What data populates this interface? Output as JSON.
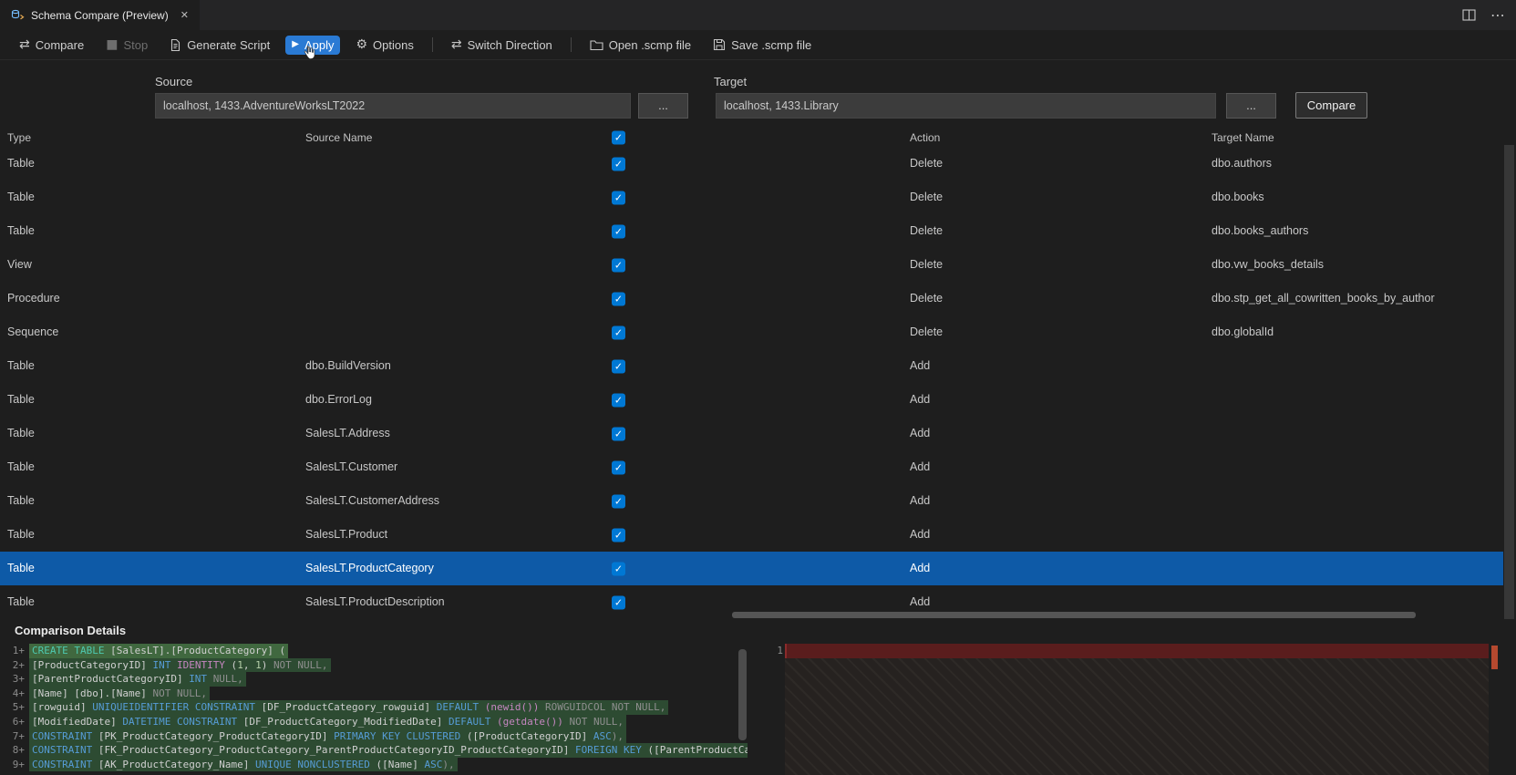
{
  "tab": {
    "title": "Schema Compare (Preview)",
    "close_glyph": "✕",
    "more_glyph": "⋯"
  },
  "toolbar": {
    "items": [
      {
        "label": "Compare"
      },
      {
        "label": "Stop",
        "disabled": true
      },
      {
        "label": "Generate Script"
      },
      {
        "label": "Apply",
        "active": true
      },
      {
        "label": "Options"
      },
      {
        "label": "Switch Direction"
      },
      {
        "label": "Open .scmp file"
      },
      {
        "label": "Save .scmp file"
      }
    ],
    "play_glyph": "▶",
    "stop_glyph": "■",
    "arrows_glyph": "⇄",
    "gear_glyph": "⚙"
  },
  "connection": {
    "source_label": "Source",
    "target_label": "Target",
    "source_value": "localhost, 1433.AdventureWorksLT2022",
    "target_value": "localhost, 1433.Library",
    "browse_label": "...",
    "compare_button": "Compare"
  },
  "grid": {
    "check_glyph": "✓",
    "columns": {
      "type": "Type",
      "source": "Source Name",
      "action": "Action",
      "target": "Target Name"
    },
    "rows": [
      {
        "type": "Table",
        "source": "",
        "checked": true,
        "action": "Delete",
        "target": "dbo.authors"
      },
      {
        "type": "Table",
        "source": "",
        "checked": true,
        "action": "Delete",
        "target": "dbo.books"
      },
      {
        "type": "Table",
        "source": "",
        "checked": true,
        "action": "Delete",
        "target": "dbo.books_authors"
      },
      {
        "type": "View",
        "source": "",
        "checked": true,
        "action": "Delete",
        "target": "dbo.vw_books_details"
      },
      {
        "type": "Procedure",
        "source": "",
        "checked": true,
        "action": "Delete",
        "target": "dbo.stp_get_all_cowritten_books_by_author"
      },
      {
        "type": "Sequence",
        "source": "",
        "checked": true,
        "action": "Delete",
        "target": "dbo.globalId"
      },
      {
        "type": "Table",
        "source": "dbo.BuildVersion",
        "checked": true,
        "action": "Add",
        "target": ""
      },
      {
        "type": "Table",
        "source": "dbo.ErrorLog",
        "checked": true,
        "action": "Add",
        "target": ""
      },
      {
        "type": "Table",
        "source": "SalesLT.Address",
        "checked": true,
        "action": "Add",
        "target": ""
      },
      {
        "type": "Table",
        "source": "SalesLT.Customer",
        "checked": true,
        "action": "Add",
        "target": ""
      },
      {
        "type": "Table",
        "source": "SalesLT.CustomerAddress",
        "checked": true,
        "action": "Add",
        "target": ""
      },
      {
        "type": "Table",
        "source": "SalesLT.Product",
        "checked": true,
        "action": "Add",
        "target": ""
      },
      {
        "type": "Table",
        "source": "SalesLT.ProductCategory",
        "checked": true,
        "action": "Add",
        "target": "",
        "selected": true
      },
      {
        "type": "Table",
        "source": "SalesLT.ProductDescription",
        "checked": true,
        "action": "Add",
        "target": ""
      }
    ]
  },
  "details": {
    "title": "Comparison Details"
  },
  "diff": {
    "right_gutter": "1",
    "left_lines": [
      {
        "num": "1+",
        "emph": true,
        "tokens": [
          [
            "CREATE TABLE",
            "teal"
          ],
          [
            " [SalesLT].[ProductCategory] (",
            "id"
          ]
        ]
      },
      {
        "num": "2+",
        "tokens": [
          [
            "[ProductCategoryID] ",
            "id"
          ],
          [
            "INT",
            "kw"
          ],
          [
            " ",
            "id"
          ],
          [
            "IDENTITY",
            "mag"
          ],
          [
            " (",
            "id"
          ],
          [
            "1",
            "num"
          ],
          [
            ", ",
            "id"
          ],
          [
            "1",
            "num"
          ],
          [
            ") ",
            "id"
          ],
          [
            "NOT NULL,",
            "gray"
          ]
        ]
      },
      {
        "num": "3+",
        "tokens": [
          [
            "[ParentProductCategoryID] ",
            "id"
          ],
          [
            "INT",
            "kw"
          ],
          [
            " ",
            "id"
          ],
          [
            "NULL,",
            "gray"
          ]
        ]
      },
      {
        "num": "4+",
        "tokens": [
          [
            "[Name] [dbo].[Name] ",
            "id"
          ],
          [
            "NOT NULL,",
            "gray"
          ]
        ]
      },
      {
        "num": "5+",
        "tokens": [
          [
            "[rowguid] ",
            "id"
          ],
          [
            "UNIQUEIDENTIFIER",
            "kw"
          ],
          [
            " ",
            "id"
          ],
          [
            "CONSTRAINT",
            "kw"
          ],
          [
            " [DF_ProductCategory_rowguid] ",
            "id"
          ],
          [
            "DEFAULT",
            "kw"
          ],
          [
            " ",
            "id"
          ],
          [
            "(newid())",
            "mag"
          ],
          [
            " ",
            "id"
          ],
          [
            "ROWGUIDCOL NOT NULL,",
            "gray"
          ]
        ]
      },
      {
        "num": "6+",
        "tokens": [
          [
            "[ModifiedDate] ",
            "id"
          ],
          [
            "DATETIME",
            "kw"
          ],
          [
            " ",
            "id"
          ],
          [
            "CONSTRAINT",
            "kw"
          ],
          [
            " [DF_ProductCategory_ModifiedDate] ",
            "id"
          ],
          [
            "DEFAULT",
            "kw"
          ],
          [
            " ",
            "id"
          ],
          [
            "(getdate())",
            "mag"
          ],
          [
            " ",
            "id"
          ],
          [
            "NOT NULL,",
            "gray"
          ]
        ]
      },
      {
        "num": "7+",
        "tokens": [
          [
            "CONSTRAINT",
            "kw"
          ],
          [
            " [PK_ProductCategory_ProductCategoryID] ",
            "id"
          ],
          [
            "PRIMARY KEY CLUSTERED",
            "kw"
          ],
          [
            " ([ProductCategoryID] ",
            "id"
          ],
          [
            "ASC",
            "kw"
          ],
          [
            "),",
            "gray"
          ]
        ]
      },
      {
        "num": "8+",
        "tokens": [
          [
            "CONSTRAINT",
            "kw"
          ],
          [
            " [FK_ProductCategory_ProductCategory_ParentProductCategoryID_ProductCategoryID] ",
            "id"
          ],
          [
            "FOREIGN KEY",
            "kw"
          ],
          [
            " ([ParentProductCatego",
            "id"
          ]
        ]
      },
      {
        "num": "9+",
        "tokens": [
          [
            "CONSTRAINT",
            "kw"
          ],
          [
            " [AK_ProductCategory_Name] ",
            "id"
          ],
          [
            "UNIQUE NONCLUSTERED",
            "kw"
          ],
          [
            " ([Name] ",
            "id"
          ],
          [
            "ASC",
            "kw"
          ],
          [
            "),",
            "gray"
          ]
        ]
      }
    ]
  },
  "colors": {
    "accent": "#0078d4",
    "selection": "#0e5aa7",
    "added_bg": "#2d4b32",
    "removed_bg": "#5a1d1d"
  }
}
